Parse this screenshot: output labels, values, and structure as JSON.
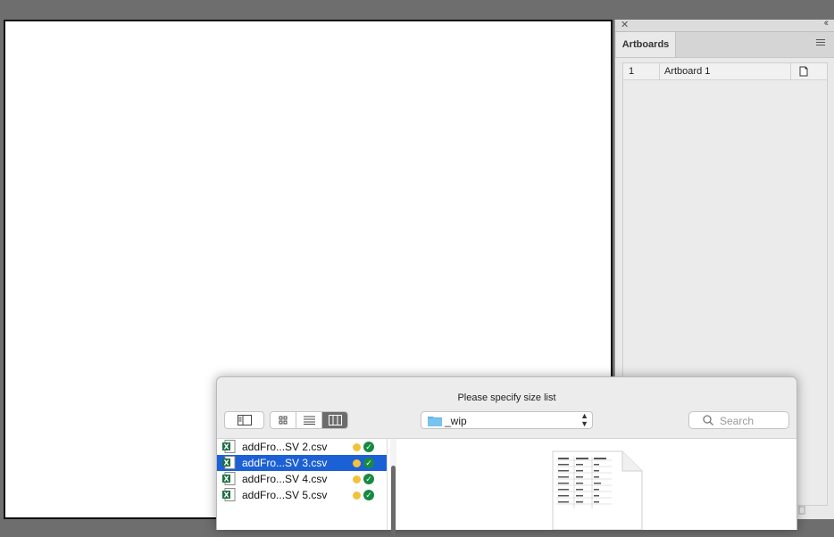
{
  "panel": {
    "tab_label": "Artboards",
    "artboards": [
      {
        "num": "1",
        "name": "Artboard 1"
      }
    ]
  },
  "dialog": {
    "title": "Please specify size list",
    "path_label": "_wip",
    "search_placeholder": "Search",
    "files": [
      {
        "name": "addFro...SV 2.csv",
        "selected": false
      },
      {
        "name": "addFro...SV 3.csv",
        "selected": true
      },
      {
        "name": "addFro...SV 4.csv",
        "selected": false
      },
      {
        "name": "addFro...SV 5.csv",
        "selected": false
      }
    ]
  },
  "colors": {
    "selection": "#1c60d6",
    "tag_yellow": "#f2c23d",
    "status_green": "#178a41",
    "excel_green": "#1d6f42",
    "folder_blue": "#5fb4ea"
  }
}
